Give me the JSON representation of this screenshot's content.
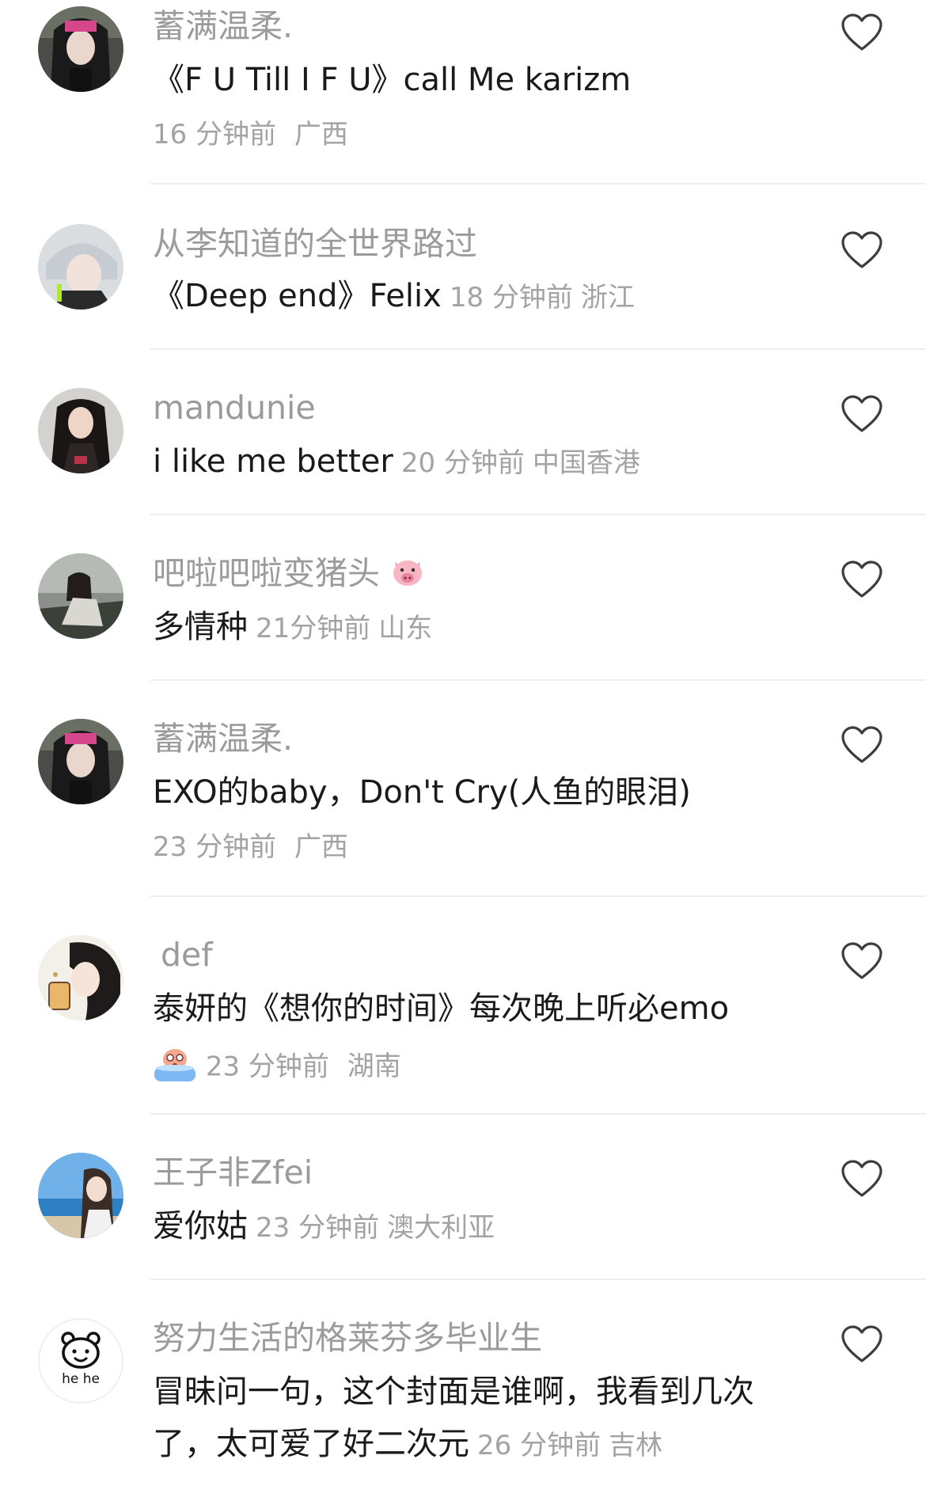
{
  "comments": [
    {
      "username": "蓄满温柔.",
      "text": "《F U Till I F U》call Me karizm",
      "time": "16 分钟前",
      "location": "广西",
      "avatar": "avatar-girl-dark-hair",
      "like_icon": "heart-outline-icon"
    },
    {
      "username": "从李知道的全世界路过",
      "text": "《Deep end》Felix",
      "time": "18 分钟前",
      "location": "浙江",
      "avatar": "avatar-silver-hair",
      "like_icon": "heart-outline-icon"
    },
    {
      "username": "mandunie",
      "text": "i like me better",
      "time": "20 分钟前",
      "location": "中国香港",
      "avatar": "avatar-woman-long-hair",
      "like_icon": "heart-outline-icon"
    },
    {
      "username": "吧啦吧啦变猪头",
      "username_emoji": "pig-face",
      "text": "多情种",
      "time": "21分钟前",
      "location": "山东",
      "avatar": "avatar-girl-seated",
      "like_icon": "heart-outline-icon"
    },
    {
      "username": "蓄满温柔.",
      "text": "EXO的baby，Don't Cry(人鱼的眼泪)",
      "time": "23 分钟前",
      "location": "广西",
      "avatar": "avatar-girl-dark-hair",
      "like_icon": "heart-outline-icon"
    },
    {
      "username": "def",
      "text": "泰妍的《想你的时间》每次晚上听必emo",
      "meta_emoji": "crying-in-bath",
      "time": "23 分钟前",
      "location": "湖南",
      "avatar": "avatar-illustrated-girl",
      "like_icon": "heart-outline-icon"
    },
    {
      "username": "王子非Zfei",
      "text": "爱你姑",
      "time": "23 分钟前",
      "location": "澳大利亚",
      "avatar": "avatar-girl-seaside",
      "like_icon": "heart-outline-icon"
    },
    {
      "username": "努力生活的格莱芬多毕业生",
      "text_line1": "冒昧问一句，这个封面是谁啊，我看到几次",
      "text_line2": "了，太可爱了好二次元",
      "time": "26 分钟前",
      "location": "吉林",
      "avatar": "avatar-hehe-bear",
      "avatar_caption": "he he",
      "like_icon": "heart-outline-icon"
    }
  ]
}
